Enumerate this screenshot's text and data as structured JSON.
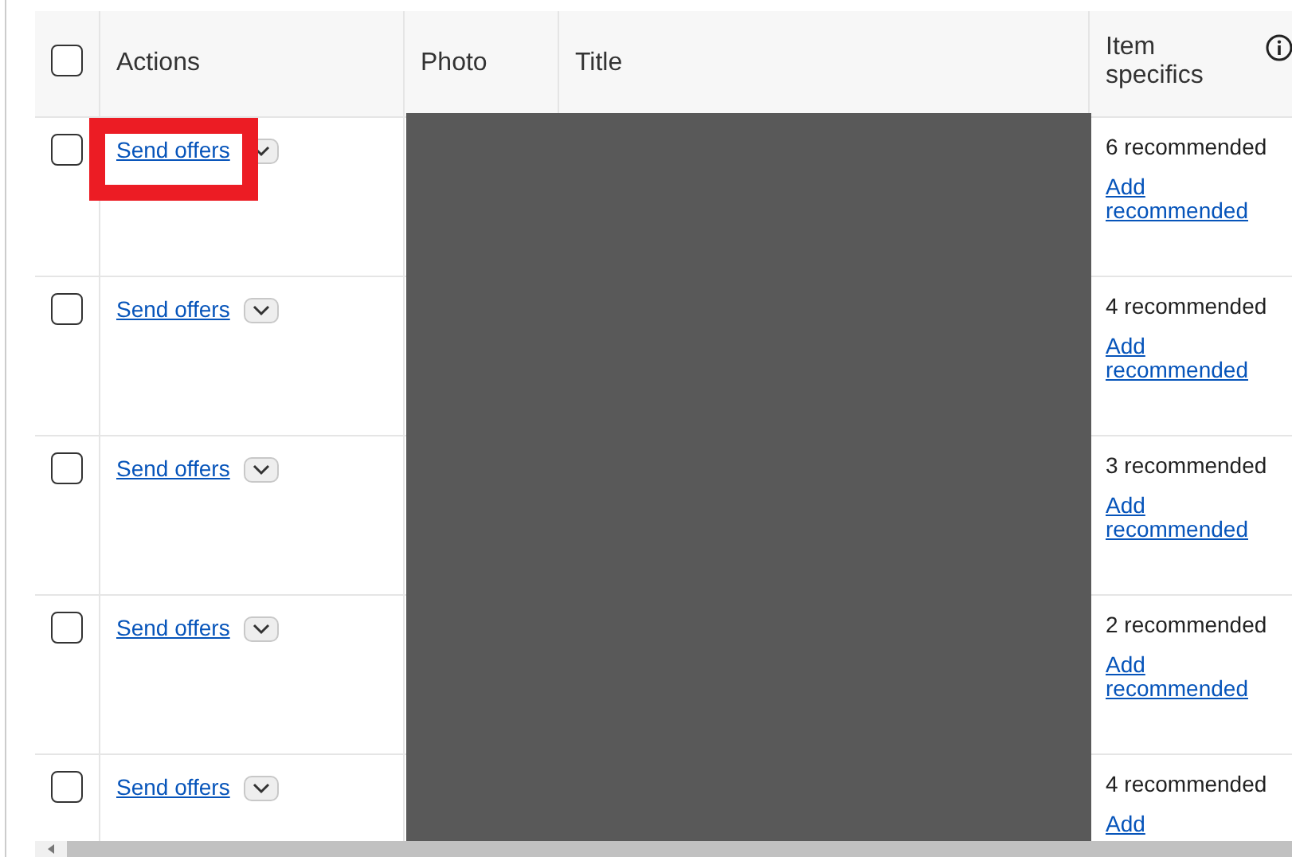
{
  "header": {
    "select_all": {
      "checked": false
    },
    "columns": [
      "Actions",
      "Photo",
      "Title",
      "Item specifics"
    ]
  },
  "rows": [
    {
      "checked": false,
      "action": "Send offers",
      "specifics": "6 recommended",
      "link": "Add recommended",
      "highlighted": true
    },
    {
      "checked": false,
      "action": "Send offers",
      "specifics": "4 recommended",
      "link": "Add recommended",
      "highlighted": false
    },
    {
      "checked": false,
      "action": "Send offers",
      "specifics": "3 recommended",
      "link": "Add recommended",
      "highlighted": false
    },
    {
      "checked": false,
      "action": "Send offers",
      "specifics": "2 recommended",
      "link": "Add recommended",
      "highlighted": false
    },
    {
      "checked": false,
      "action": "Send offers",
      "specifics": "4 recommended",
      "link": "Add",
      "highlighted": false
    }
  ]
}
